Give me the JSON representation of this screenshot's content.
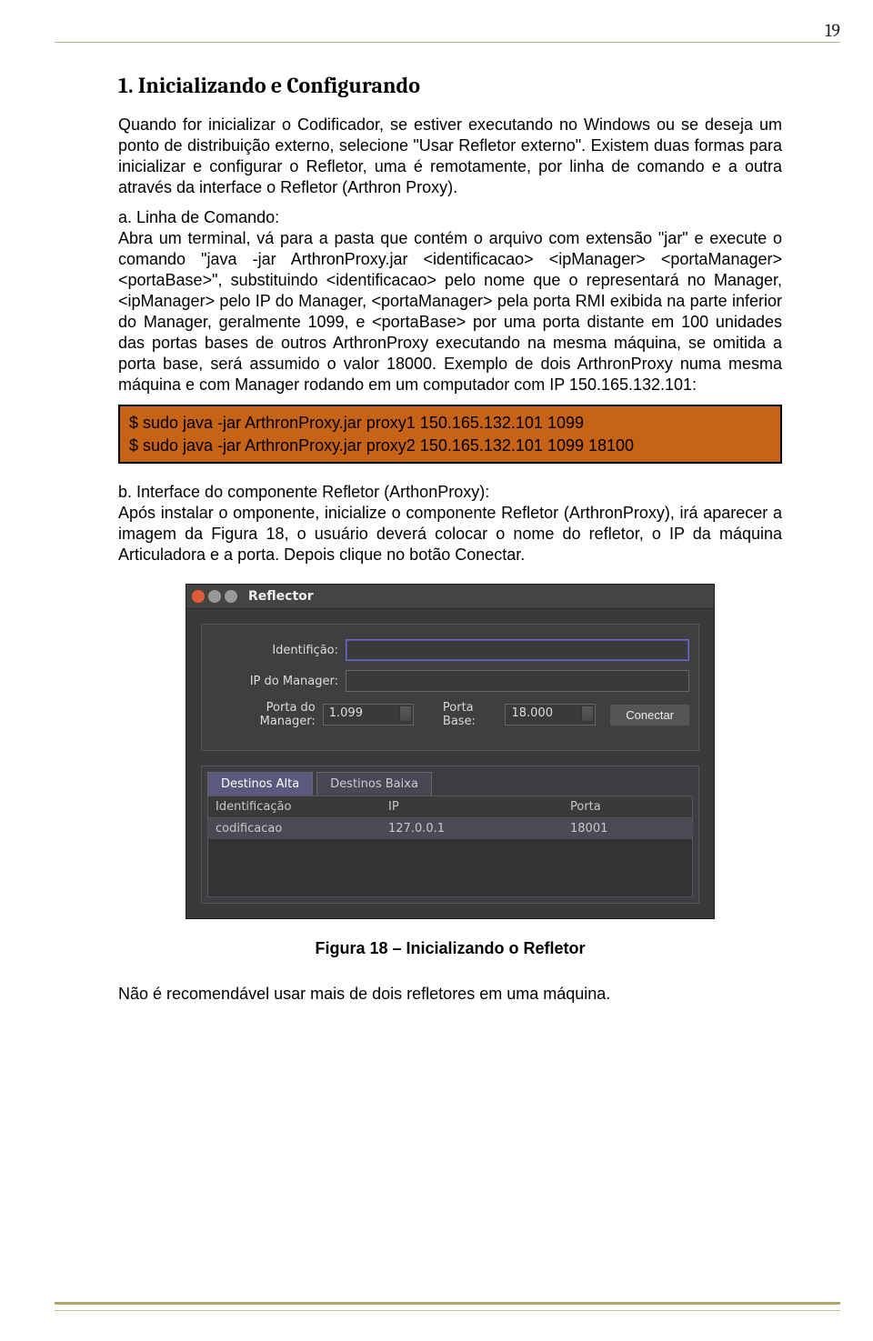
{
  "page_number": "19",
  "h1": "1. Inicializando e Configurando",
  "p1": "Quando for inicializar o Codificador, se estiver executando no Windows ou se deseja um ponto de distribuição externo, selecione \"Usar Refletor externo\". Existem duas formas para inicializar e configurar o Refletor, uma é remotamente, por linha de comando e a outra através da interface o Refletor (Arthron Proxy).",
  "p2": "a. Linha de Comando:\nAbra um terminal, vá para a pasta que contém o arquivo com extensão \"jar\" e execute o comando \"java -jar ArthronProxy.jar <identificacao> <ipManager> <portaManager> <portaBase>\", substituindo <identificacao> pelo nome que o representará no Manager, <ipManager> pelo IP do Manager, <portaManager> pela porta RMI exibida na parte inferior do Manager, geralmente 1099, e <portaBase> por uma porta distante em 100 unidades das portas bases de outros ArthronProxy executando na mesma máquina, se omitida a porta base, será assumido o valor 18000. Exemplo de dois ArthronProxy numa mesma máquina e com Manager rodando em um computador com IP 150.165.132.101:",
  "code": {
    "line1": "$ sudo java -jar ArthronProxy.jar proxy1 150.165.132.101 1099",
    "line2": "$ sudo java -jar ArthronProxy.jar proxy2 150.165.132.101 1099 18100"
  },
  "p3": "b. Interface do componente Refletor (ArthonProxy):\nApós instalar o omponente, inicialize o componente Refletor (ArthronProxy), irá aparecer a imagem da Figura 18, o usuário deverá colocar o nome do refletor, o IP da máquina Articuladora e a porta.  Depois clique no botão Conectar.",
  "reflector": {
    "window_title": "Reflector",
    "labels": {
      "ident": "Identifição:",
      "ip": "IP do Manager:",
      "porta_manager": "Porta do Manager:",
      "porta_base": "Porta Base:"
    },
    "values": {
      "porta_manager": "1.099",
      "porta_base": "18.000"
    },
    "btn_connect": "Conectar",
    "tabs": {
      "alta": "Destinos Alta",
      "baixa": "Destinos Baixa"
    },
    "grid": {
      "h1": "Identificação",
      "h2": "IP",
      "h3": "Porta",
      "r1c1": "codificacao",
      "r1c2": "127.0.0.1",
      "r1c3": "18001"
    }
  },
  "figure_caption": "Figura 18 – Inicializando o Refletor",
  "p4": "Não é recomendável usar mais de dois refletores em uma máquina."
}
